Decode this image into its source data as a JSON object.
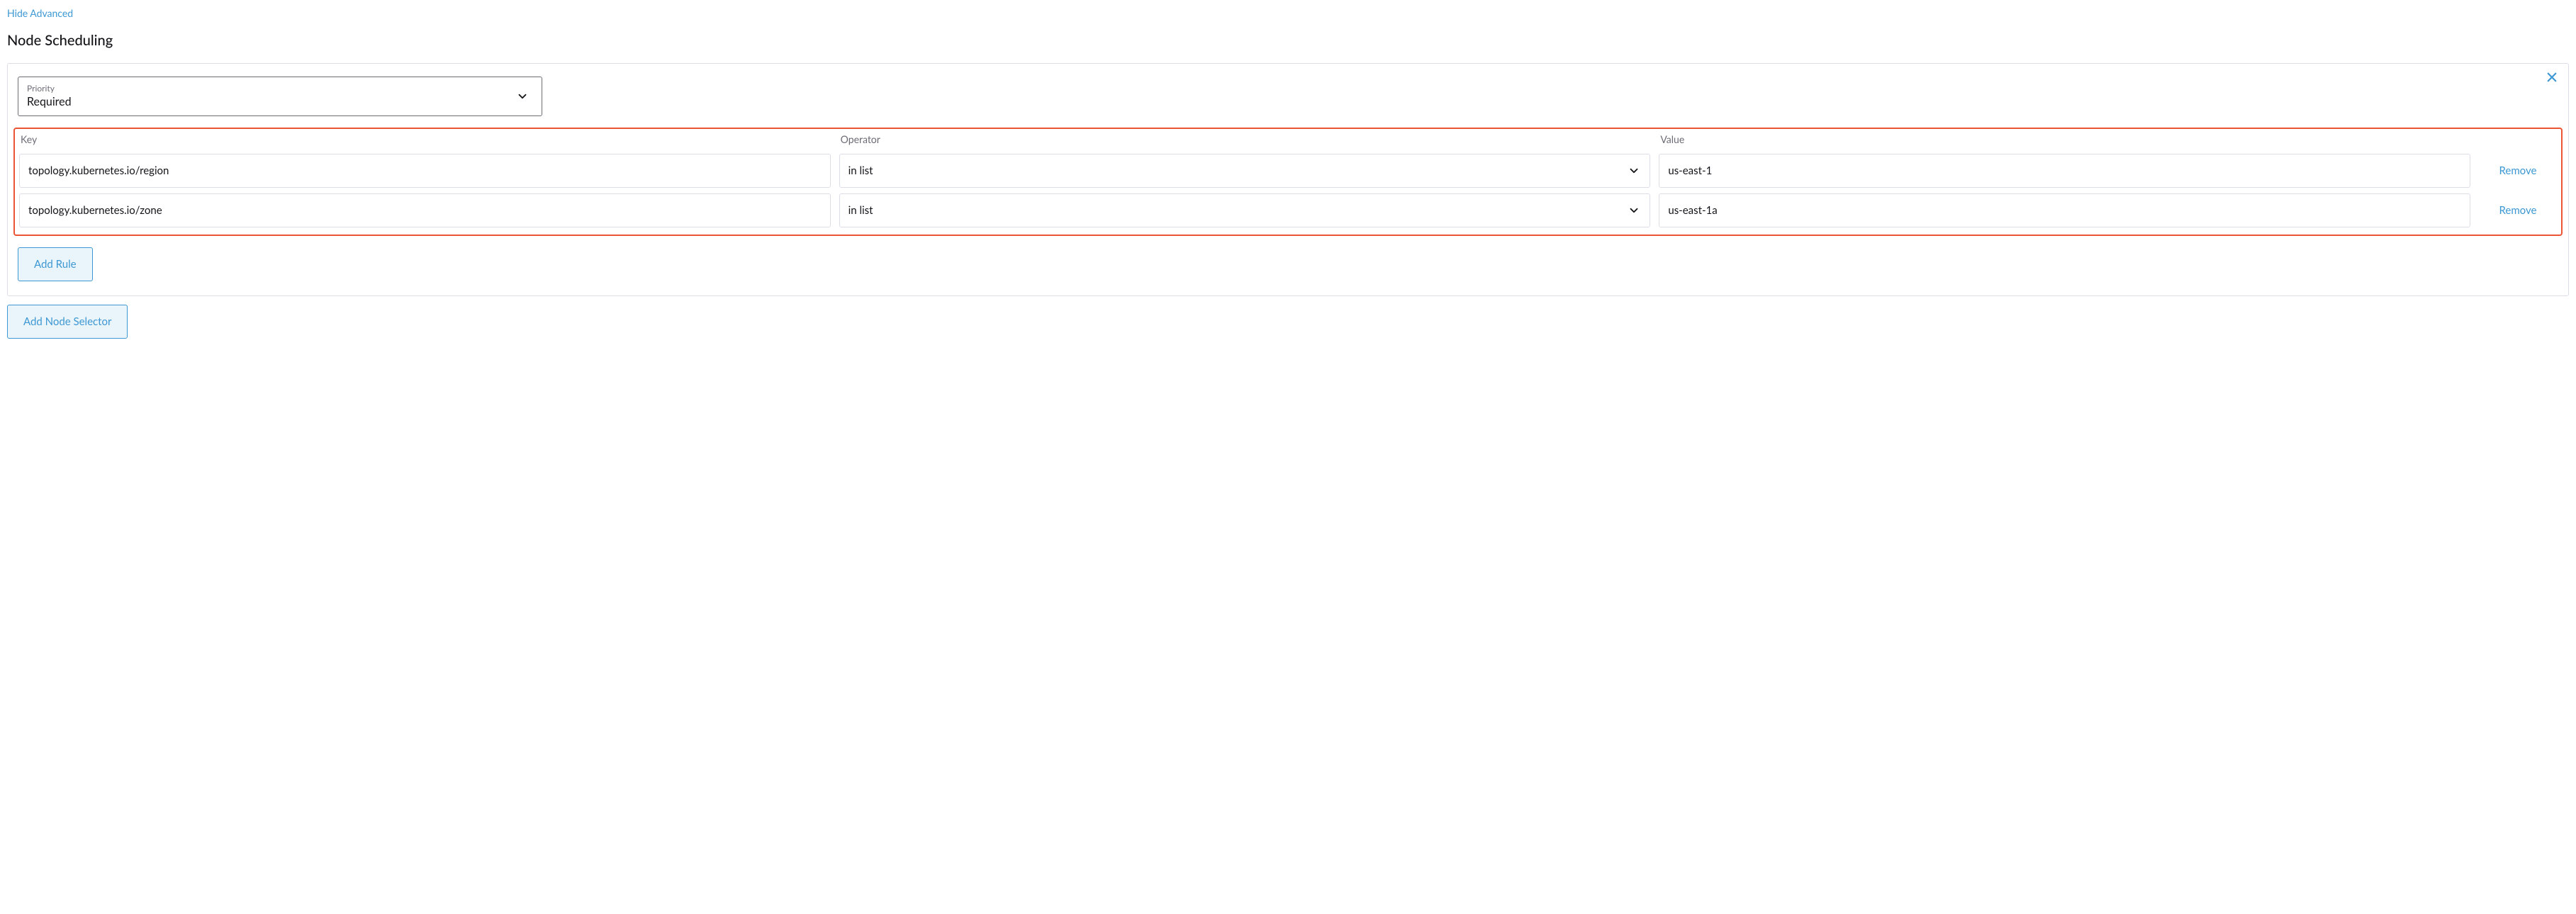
{
  "header": {
    "hide_advanced": "Hide Advanced",
    "section_title": "Node Scheduling"
  },
  "priority": {
    "label": "Priority",
    "value": "Required"
  },
  "columns": {
    "key": "Key",
    "operator": "Operator",
    "value": "Value"
  },
  "rules": [
    {
      "key": "topology.kubernetes.io/region",
      "operator": "in list",
      "value": "us-east-1",
      "remove": "Remove"
    },
    {
      "key": "topology.kubernetes.io/zone",
      "operator": "in list",
      "value": "us-east-1a",
      "remove": "Remove"
    }
  ],
  "buttons": {
    "add_rule": "Add Rule",
    "add_node_selector": "Add Node Selector"
  }
}
